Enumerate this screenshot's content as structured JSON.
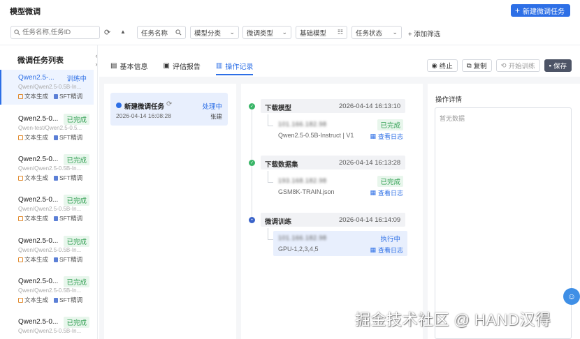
{
  "header": {
    "title": "模型微调",
    "new_button": "新建微调任务"
  },
  "filters": {
    "search_placeholder": "任务名称,任务ID",
    "task_name": "任务名称",
    "model_category": "模型分类",
    "finetune_type": "微调类型",
    "base_model": "基础模型",
    "task_status": "任务状态",
    "add_filter": "添加筛选"
  },
  "sidebar": {
    "title": "微调任务列表",
    "items": [
      {
        "name": "Qwen2.5-...",
        "status": "训练中",
        "sub": "Qwen/Qwen2.5-0.5B-In...",
        "tag1": "文本生成",
        "tag2": "SFT精调"
      },
      {
        "name": "Qwen2.5-0...",
        "status": "已完成",
        "sub": "Qwen-test/Qwen2.5-0.5...",
        "tag1": "文本生成",
        "tag2": "SFT精调"
      },
      {
        "name": "Qwen2.5-0...",
        "status": "已完成",
        "sub": "Qwen/Qwen2.5-0.5B-In...",
        "tag1": "文本生成",
        "tag2": "SFT精调"
      },
      {
        "name": "Qwen2.5-0...",
        "status": "已完成",
        "sub": "Qwen/Qwen2.5-0.5B-In...",
        "tag1": "文本生成",
        "tag2": "SFT精调"
      },
      {
        "name": "Qwen2.5-0...",
        "status": "已完成",
        "sub": "Qwen/Qwen2.5-0.5B-In...",
        "tag1": "文本生成",
        "tag2": "SFT精调"
      },
      {
        "name": "Qwen2.5-0...",
        "status": "已完成",
        "sub": "Qwen/Qwen2.5-0.5B-In...",
        "tag1": "文本生成",
        "tag2": "SFT精调"
      },
      {
        "name": "Qwen2.5-0...",
        "status": "已完成",
        "sub": "Qwen/Qwen2.5-0.5B-In...",
        "tag1": "",
        "tag2": ""
      }
    ]
  },
  "tabs": [
    {
      "label": "基本信息"
    },
    {
      "label": "评估报告"
    },
    {
      "label": "操作记录"
    }
  ],
  "toolbar": {
    "stop": "终止",
    "copy": "复制",
    "start": "开始训练",
    "save": "保存"
  },
  "operation": {
    "title": "新建微调任务",
    "status": "处理中",
    "time": "2026-04-14 16:08:28",
    "user": "张建"
  },
  "steps": [
    {
      "name": "下载模型",
      "time": "2026-04-14 16:13:10",
      "host": "101.166.182.98",
      "detail": "Qwen2.5-0.5B-Instruct | V1",
      "status": "已完成",
      "log": "查看日志"
    },
    {
      "name": "下载数据集",
      "time": "2026-04-14 16:13:28",
      "host": "193.168.182.98",
      "detail": "GSM8K-TRAIN.json",
      "status": "已完成",
      "log": "查看日志"
    },
    {
      "name": "微调训练",
      "time": "2026-04-14 16:14:09",
      "host": "101.166.182.98",
      "detail": "GPU-1,2,3,4,5",
      "status": "执行中",
      "log": "查看日志"
    }
  ],
  "details": {
    "title": "操作详情",
    "empty": "暂无数据"
  },
  "watermark": "掘金技术社区 @ HAND汉得",
  "colors": {
    "primary": "#2d6fe6",
    "success": "#2e9e50",
    "save": "#4d5466"
  }
}
